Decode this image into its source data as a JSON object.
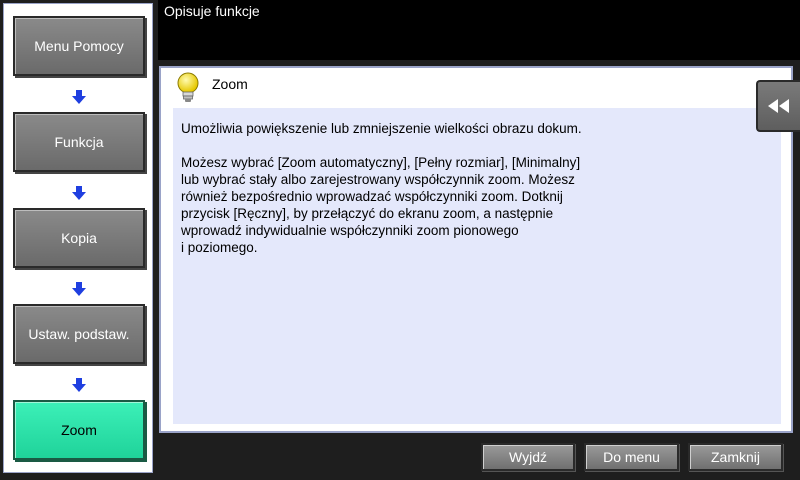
{
  "header": {
    "title": "Opisuje funkcje"
  },
  "nav": {
    "items": [
      {
        "label": "Menu Pomocy"
      },
      {
        "label": "Funkcja"
      },
      {
        "label": "Kopia"
      },
      {
        "label": "Ustaw. podstaw."
      },
      {
        "label": "Zoom",
        "active": true
      }
    ]
  },
  "content": {
    "title": "Zoom",
    "paragraphs": [
      "Umożliwia powiększenie lub zmniejszenie wielkości obrazu dokum.",
      "Możesz wybrać [Zoom automatyczny], [Pełny rozmiar], [Minimalny]\nlub wybrać stały albo zarejestrowany współczynnik zoom. Możesz\nrównież bezpośrednio wprowadzać współczynniki zoom. Dotknij\nprzycisk [Ręczny], by przełączyć do ekranu zoom, a następnie\nwprowadź indywidualnie współczynniki zoom pionowego\ni poziomego."
    ]
  },
  "buttons": {
    "exit": "Wyjdź",
    "to_menu": "Do menu",
    "close": "Zamknij"
  },
  "icons": {
    "bulb": "lightbulb-icon",
    "collapse": "double-chevron-left-icon",
    "arrow": "arrow-down-icon"
  },
  "colors": {
    "active_nav": "#2ee6a8",
    "content_bg": "#e4e8fb",
    "header_bg": "#000000"
  }
}
